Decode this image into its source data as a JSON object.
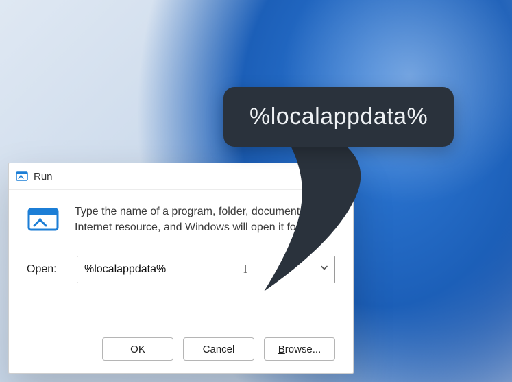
{
  "dialog": {
    "title": "Run",
    "description": "Type the name of a program, folder, document, or Internet resource, and Windows will open it for you.",
    "open_label": "Open:",
    "input_value": "%localappdata%",
    "buttons": {
      "ok": "OK",
      "cancel": "Cancel",
      "browse_prefix": "B",
      "browse_rest": "rowse..."
    }
  },
  "callout": {
    "text": "%localappdata%"
  },
  "colors": {
    "callout_bg": "#2a323c",
    "callout_fg": "#eef1f4",
    "accent": "#1c5fb8"
  }
}
